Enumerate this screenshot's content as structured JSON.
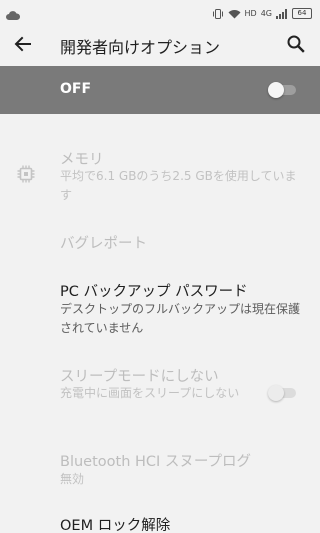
{
  "status_bar": {
    "network_label": "HD",
    "signal_label": "4G",
    "battery_level": "64"
  },
  "app_bar": {
    "title": "開発者向けオプション"
  },
  "master_switch": {
    "label": "OFF",
    "state": "off"
  },
  "items": [
    {
      "title": "メモリ",
      "summary": "平均で6.1 GBのうち2.5 GBを使用しています",
      "enabled": false
    },
    {
      "title": "バグレポート",
      "enabled": false
    },
    {
      "title": "PC バックアップ パスワード",
      "summary": "デスクトップのフルバックアップは現在保護されていません",
      "enabled": true
    },
    {
      "title": "スリープモードにしない",
      "summary": "充電中に画面をスリープにしない",
      "enabled": false,
      "switch_state": "off"
    },
    {
      "title": "Bluetooth HCI スヌープログ",
      "summary": "無効",
      "enabled": false
    },
    {
      "title": "OEM ロック解除",
      "enabled": true
    }
  ]
}
